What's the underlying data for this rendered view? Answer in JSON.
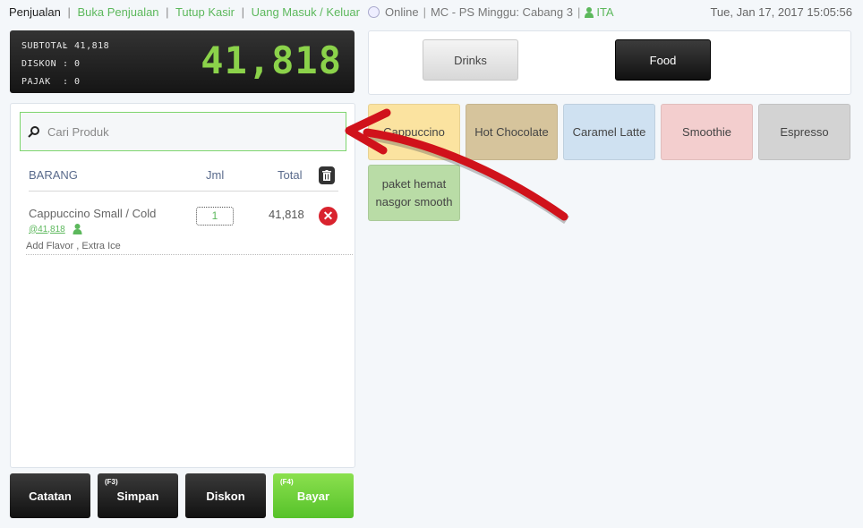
{
  "nav": {
    "items": [
      "Penjualan",
      "Buka Penjualan",
      "Tutup Kasir",
      "Uang Masuk / Keluar"
    ],
    "sep": "|"
  },
  "status": {
    "online": "Online",
    "sep": "|",
    "branch": "MC - PS Minggu: Cabang 3",
    "user": "ITA"
  },
  "datetime": "Tue, Jan 17, 2017 15:05:56",
  "display": {
    "subtotal_label": "SUBTOTAL",
    "subtotal_value": ": 41,818",
    "diskon_label": "DISKON",
    "diskon_value": ": 0",
    "pajak_label": "PAJAK",
    "pajak_value": ": 0",
    "big_total": "41,818"
  },
  "search": {
    "placeholder": "Cari Produk"
  },
  "table": {
    "col_item": "BARANG",
    "col_qty": "Jml",
    "col_total": "Total"
  },
  "lines": [
    {
      "name": "Cappuccino Small / Cold",
      "price": "@41,818",
      "qty": "1",
      "total": "41,818",
      "note": "Add Flavor , Extra Ice"
    }
  ],
  "buttons": {
    "catatan": "Catatan",
    "simpan": "Simpan",
    "simpan_key": "(F3)",
    "diskon": "Diskon",
    "bayar": "Bayar",
    "bayar_key": "(F4)"
  },
  "categories": [
    "Drinks",
    "Food"
  ],
  "products": [
    {
      "label": "Cappuccino",
      "color": "#fbe3a0"
    },
    {
      "label": "Hot Chocolate",
      "color": "#d6c49c"
    },
    {
      "label": "Caramel Latte",
      "color": "#cfe1f1"
    },
    {
      "label": "Smoothie",
      "color": "#f3cece"
    },
    {
      "label": "Espresso",
      "color": "#d3d3d3"
    },
    {
      "label": "paket hemat nasgor smooth",
      "color": "#b9dca6"
    }
  ],
  "colors": {
    "accent": "#5cb85c",
    "lcd_green": "#8bd24a",
    "delete": "#d9232e",
    "annotation_arrow": "#d0121b"
  }
}
